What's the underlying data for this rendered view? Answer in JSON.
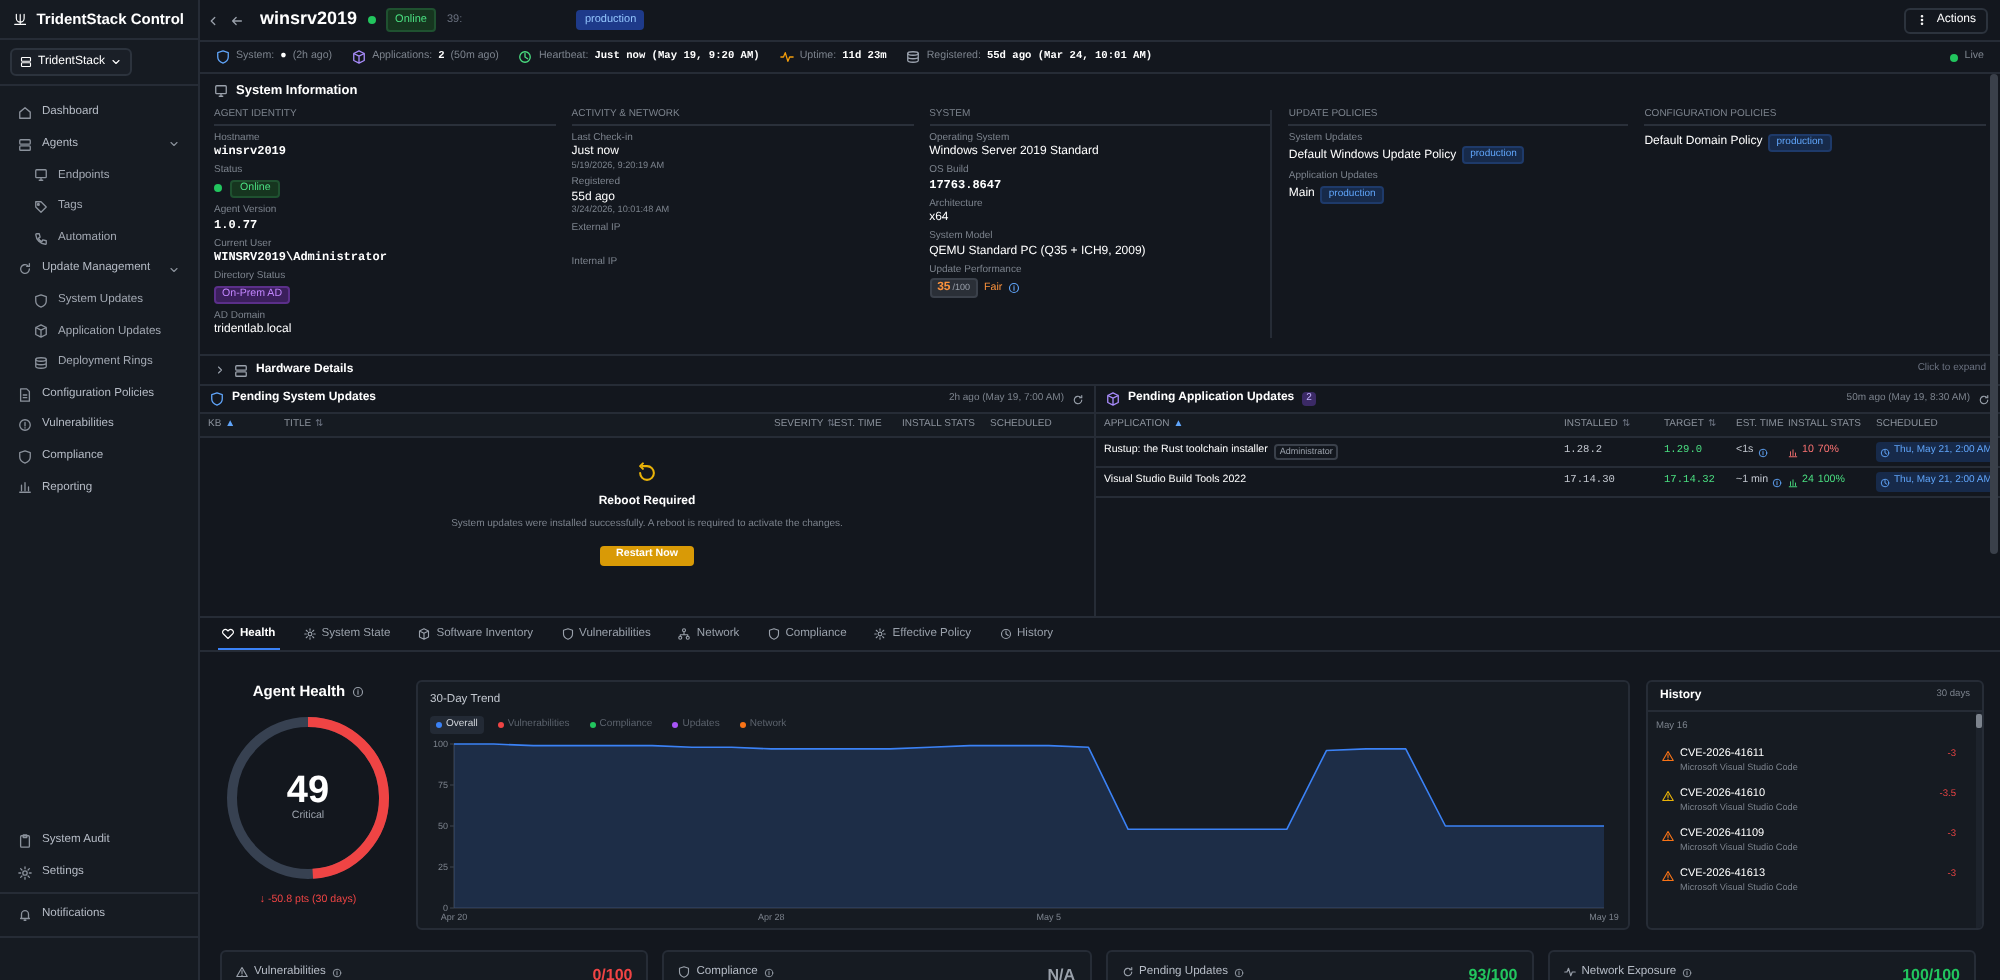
{
  "app": {
    "title": "TridentStack Control",
    "workspace": "TridentStack"
  },
  "sidebar": {
    "items": [
      {
        "label": "Dashboard"
      },
      {
        "label": "Agents",
        "expanded": true,
        "children": [
          {
            "label": "Endpoints"
          },
          {
            "label": "Tags"
          },
          {
            "label": "Automation"
          }
        ]
      },
      {
        "label": "Update Management",
        "expanded": true,
        "children": [
          {
            "label": "System Updates"
          },
          {
            "label": "Application Updates"
          },
          {
            "label": "Deployment Rings"
          }
        ]
      },
      {
        "label": "Configuration Policies"
      },
      {
        "label": "Vulnerabilities"
      },
      {
        "label": "Compliance"
      },
      {
        "label": "Reporting"
      }
    ],
    "bottom_items": [
      {
        "label": "System Audit"
      },
      {
        "label": "Settings"
      }
    ],
    "footer_items": [
      {
        "label": "Notifications"
      }
    ]
  },
  "header": {
    "title": "winsrv2019",
    "status": "Online",
    "online": true,
    "extra": "39:",
    "tag": "production",
    "actions": "Actions"
  },
  "status_strip": [
    {
      "label": "System:",
      "value": "●",
      "note": "(2h ago)"
    },
    {
      "label": "Applications:",
      "value": "2",
      "note": "(50m ago)"
    },
    {
      "label": "Heartbeat:",
      "value": "Just now (May 19, 9:20 AM)"
    },
    {
      "label": "Uptime:",
      "value": "11d 23m"
    },
    {
      "label": "Registered:",
      "value": "55d ago (Mar 24, 10:01 AM)"
    }
  ],
  "live": "Live",
  "system_information": {
    "title": "System Information",
    "columns": [
      {
        "heading": "AGENT IDENTITY",
        "fields": [
          {
            "label": "Hostname",
            "value": "winsrv2019",
            "kind": "mono"
          },
          {
            "label": "Status",
            "value": "Online",
            "kind": "status"
          },
          {
            "label": "Agent Version",
            "value": "1.0.77",
            "kind": "mono"
          },
          {
            "label": "Current User",
            "value": "WINSRV2019\\Administrator",
            "kind": "mono"
          },
          {
            "label": "Directory Status",
            "value": "On-Prem AD",
            "kind": "purple_badge"
          },
          {
            "label": "AD Domain",
            "value": "tridentlab.local",
            "kind": "text"
          }
        ]
      },
      {
        "heading": "ACTIVITY & NETWORK",
        "fields": [
          {
            "label": "Last Check-in",
            "value": "Just now",
            "sub": "5/19/2026, 9:20:19 AM",
            "kind": "text"
          },
          {
            "label": "Registered",
            "value": "55d ago",
            "sub": "3/24/2026, 10:01:48 AM",
            "kind": "text"
          },
          {
            "label": "External IP",
            "kind": "empty"
          },
          {
            "label": "Internal IP",
            "kind": "empty"
          }
        ]
      },
      {
        "heading": "SYSTEM",
        "fields": [
          {
            "label": "Operating System",
            "value": "Windows Server 2019 Standard",
            "kind": "text"
          },
          {
            "label": "OS Build",
            "value": "17763.8647",
            "kind": "mono"
          },
          {
            "label": "Architecture",
            "value": "x64",
            "kind": "text"
          },
          {
            "label": "System Model",
            "value": "QEMU Standard PC (Q35 + ICH9, 2009)",
            "kind": "text"
          },
          {
            "label": "Update Performance",
            "value": "35",
            "max": "/100",
            "rating": "Fair",
            "kind": "score"
          }
        ]
      },
      {
        "heading": "UPDATE POLICIES",
        "fields": [
          {
            "label": "System Updates",
            "value": "Default Windows Update Policy",
            "tag": "production",
            "kind": "policy"
          },
          {
            "label": "Application Updates",
            "value": "Main",
            "tag": "production",
            "kind": "policy"
          }
        ]
      },
      {
        "heading": "CONFIGURATION POLICIES",
        "fields": [
          {
            "value": "Default Domain Policy",
            "tag": "production",
            "kind": "policy"
          }
        ]
      }
    ]
  },
  "hardware_details": {
    "title": "Hardware Details",
    "expanded": false,
    "hint": "Click to expand"
  },
  "pending_system_updates": {
    "title": "Pending System Updates",
    "refreshed": "2h ago (May 19, 7:00 AM)",
    "columns": [
      {
        "label": "KB",
        "sort": "▲"
      },
      {
        "label": "TITLE",
        "sort": "⇅"
      },
      {
        "label": "SEVERITY",
        "sort": "⇅"
      },
      {
        "label": "EST. TIME"
      },
      {
        "label": "INSTALL STATS"
      },
      {
        "label": "SCHEDULED"
      }
    ],
    "notice": {
      "title": "Reboot Required",
      "message": "System updates were installed successfully. A reboot is required to activate the changes.",
      "button": "Restart Now"
    }
  },
  "pending_application_updates": {
    "title": "Pending Application Updates",
    "count": "2",
    "refreshed": "50m ago (May 19, 8:30 AM)",
    "columns": [
      {
        "label": "APPLICATION",
        "sort": "▲"
      },
      {
        "label": "INSTALLED",
        "sort": "⇅"
      },
      {
        "label": "TARGET",
        "sort": "⇅"
      },
      {
        "label": "EST. TIME"
      },
      {
        "label": "INSTALL STATS"
      },
      {
        "label": "SCHEDULED"
      }
    ],
    "rows": [
      {
        "application": "Rustup: the Rust toolchain installer",
        "tag": "Administrator",
        "installed": "1.28.2",
        "target": "1.29.0",
        "est_time": "<1s",
        "stats_count": "10",
        "stats_percent": "70%",
        "stats_ok": false,
        "scheduled": "Thu, May 21, 2:00 AM"
      },
      {
        "application": "Visual Studio Build Tools 2022",
        "installed": "17.14.30",
        "target": "17.14.32",
        "est_time": "~1 min",
        "stats_count": "24",
        "stats_percent": "100%",
        "stats_ok": true,
        "scheduled": "Thu, May 21, 2:00 AM"
      }
    ]
  },
  "tabs": [
    {
      "label": "Health",
      "selected": true
    },
    {
      "label": "System State",
      "selected": false
    },
    {
      "label": "Software Inventory",
      "selected": false
    },
    {
      "label": "Vulnerabilities",
      "selected": false
    },
    {
      "label": "Network",
      "selected": false
    },
    {
      "label": "Compliance",
      "selected": false
    },
    {
      "label": "Effective Policy",
      "selected": false
    },
    {
      "label": "History",
      "selected": false
    }
  ],
  "agent_health": {
    "title": "Agent Health",
    "score": "49",
    "level": 0.49,
    "rating": "Critical",
    "trend": "↓ -50.8 pts (30 days)"
  },
  "trend": {
    "title": "30-Day Trend",
    "legend": [
      {
        "label": "Vulnerabilities",
        "color": "#ef4444",
        "active": false
      },
      {
        "label": "Compliance",
        "color": "#22c55e",
        "active": false
      },
      {
        "label": "Updates",
        "color": "#a855f7",
        "active": false
      },
      {
        "label": "Network",
        "color": "#f97316",
        "active": false
      }
    ],
    "chart_data": {
      "type": "area",
      "categories": [
        "Apr 20",
        null,
        null,
        null,
        null,
        null,
        null,
        null,
        "Apr 28",
        null,
        null,
        null,
        null,
        null,
        null,
        "May 5",
        null,
        null,
        null,
        null,
        null,
        null,
        null,
        null,
        null,
        null,
        null,
        null,
        null,
        "May 19"
      ],
      "series": [
        {
          "name": "Overall",
          "color": "#3b82f6",
          "values": [
            100,
            100,
            99,
            99,
            99,
            99,
            98,
            98,
            97,
            97,
            97,
            97,
            98,
            99,
            99,
            99,
            98,
            48,
            48,
            48,
            48,
            48,
            96,
            97,
            97,
            50,
            50,
            50,
            50,
            50
          ]
        }
      ],
      "ylim": [
        0,
        100
      ],
      "yticks": [
        0,
        25,
        50,
        75,
        100
      ]
    }
  },
  "history": {
    "title": "History",
    "range": "30 days",
    "groups": [
      {
        "date": "May 16",
        "items": [
          {
            "title": "CVE-2026-41611",
            "product": "Microsoft Visual Studio Code",
            "delta": "-3",
            "color": "#f97316"
          },
          {
            "title": "CVE-2026-41610",
            "product": "Microsoft Visual Studio Code",
            "delta": "-3.5",
            "color": "#eab308"
          },
          {
            "title": "CVE-2026-41109",
            "product": "Microsoft Visual Studio Code",
            "delta": "-3",
            "color": "#f97316"
          },
          {
            "title": "CVE-2026-41613",
            "product": "Microsoft Visual Studio Code",
            "delta": "-3",
            "color": "#f97316"
          }
        ]
      }
    ]
  },
  "score_cards": [
    {
      "label": "Vulnerabilities",
      "value": "0/100",
      "color": "#ef4444"
    },
    {
      "label": "Compliance",
      "value": "N/A",
      "color": "#9aa1ab"
    },
    {
      "label": "Pending Updates",
      "value": "93/100",
      "color": "#22c55e"
    },
    {
      "label": "Network Exposure",
      "value": "100/100",
      "color": "#22c55e"
    }
  ]
}
